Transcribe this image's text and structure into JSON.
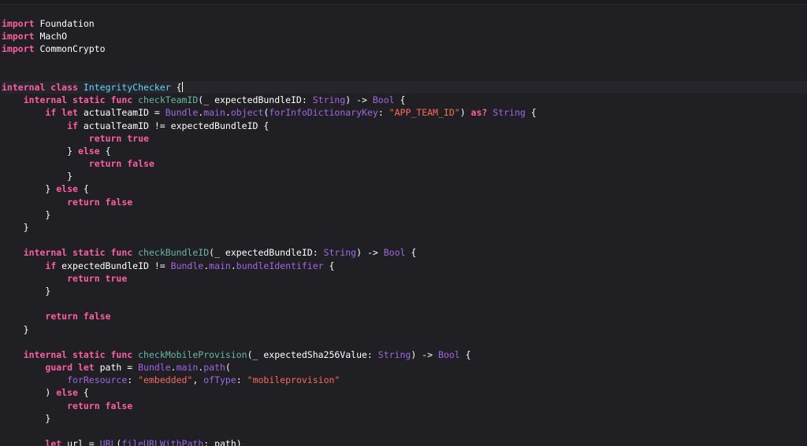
{
  "editor": {
    "colors": {
      "background": "#1f1f24",
      "keyword": "#fc5fa3",
      "type_declaration": "#5dd8ff",
      "function_declaration": "#67b7a4",
      "project_symbol": "#a167e6",
      "string": "#fc6a5d",
      "plain": "#ffffff"
    },
    "lines": [
      [
        {
          "c": "kw",
          "t": "import"
        },
        {
          "c": "pl",
          "t": " Foundation"
        }
      ],
      [
        {
          "c": "kw",
          "t": "import"
        },
        {
          "c": "pl",
          "t": " MachO"
        }
      ],
      [
        {
          "c": "kw",
          "t": "import"
        },
        {
          "c": "pl",
          "t": " CommonCrypto"
        }
      ],
      [],
      [],
      [
        {
          "c": "kw",
          "t": "internal class"
        },
        {
          "c": "pl",
          "t": " "
        },
        {
          "c": "ty",
          "t": "IntegrityChecker"
        },
        {
          "c": "pl",
          "t": " {"
        }
      ],
      [
        {
          "c": "pl",
          "t": "    "
        },
        {
          "c": "kw",
          "t": "internal static func"
        },
        {
          "c": "pl",
          "t": " "
        },
        {
          "c": "fn",
          "t": "checkTeamID"
        },
        {
          "c": "pl",
          "t": "(_ expectedBundleID: "
        },
        {
          "c": "pj",
          "t": "String"
        },
        {
          "c": "pl",
          "t": ") -> "
        },
        {
          "c": "pj",
          "t": "Bool"
        },
        {
          "c": "pl",
          "t": " {"
        }
      ],
      [
        {
          "c": "pl",
          "t": "        "
        },
        {
          "c": "kw",
          "t": "if let"
        },
        {
          "c": "pl",
          "t": " actualTeamID = "
        },
        {
          "c": "pj",
          "t": "Bundle"
        },
        {
          "c": "pl",
          "t": "."
        },
        {
          "c": "pj",
          "t": "main"
        },
        {
          "c": "pl",
          "t": "."
        },
        {
          "c": "pj",
          "t": "object"
        },
        {
          "c": "pl",
          "t": "("
        },
        {
          "c": "pj",
          "t": "forInfoDictionaryKey"
        },
        {
          "c": "pl",
          "t": ": "
        },
        {
          "c": "str",
          "t": "\"APP_TEAM_ID\""
        },
        {
          "c": "pl",
          "t": ") "
        },
        {
          "c": "kw",
          "t": "as?"
        },
        {
          "c": "pl",
          "t": " "
        },
        {
          "c": "pj",
          "t": "String"
        },
        {
          "c": "pl",
          "t": " {"
        }
      ],
      [
        {
          "c": "pl",
          "t": "            "
        },
        {
          "c": "kw",
          "t": "if"
        },
        {
          "c": "pl",
          "t": " actualTeamID != expectedBundleID {"
        }
      ],
      [
        {
          "c": "pl",
          "t": "                "
        },
        {
          "c": "kw",
          "t": "return true"
        }
      ],
      [
        {
          "c": "pl",
          "t": "            } "
        },
        {
          "c": "kw",
          "t": "else"
        },
        {
          "c": "pl",
          "t": " {"
        }
      ],
      [
        {
          "c": "pl",
          "t": "                "
        },
        {
          "c": "kw",
          "t": "return false"
        }
      ],
      [
        {
          "c": "pl",
          "t": "            }"
        }
      ],
      [
        {
          "c": "pl",
          "t": "        } "
        },
        {
          "c": "kw",
          "t": "else"
        },
        {
          "c": "pl",
          "t": " {"
        }
      ],
      [
        {
          "c": "pl",
          "t": "            "
        },
        {
          "c": "kw",
          "t": "return false"
        }
      ],
      [
        {
          "c": "pl",
          "t": "        }"
        }
      ],
      [
        {
          "c": "pl",
          "t": "    }"
        }
      ],
      [],
      [
        {
          "c": "pl",
          "t": "    "
        },
        {
          "c": "kw",
          "t": "internal static func"
        },
        {
          "c": "pl",
          "t": " "
        },
        {
          "c": "fn",
          "t": "checkBundleID"
        },
        {
          "c": "pl",
          "t": "(_ expectedBundleID: "
        },
        {
          "c": "pj",
          "t": "String"
        },
        {
          "c": "pl",
          "t": ") -> "
        },
        {
          "c": "pj",
          "t": "Bool"
        },
        {
          "c": "pl",
          "t": " {"
        }
      ],
      [
        {
          "c": "pl",
          "t": "        "
        },
        {
          "c": "kw",
          "t": "if"
        },
        {
          "c": "pl",
          "t": " expectedBundleID != "
        },
        {
          "c": "pj",
          "t": "Bundle"
        },
        {
          "c": "pl",
          "t": "."
        },
        {
          "c": "pj",
          "t": "main"
        },
        {
          "c": "pl",
          "t": "."
        },
        {
          "c": "pj",
          "t": "bundleIdentifier"
        },
        {
          "c": "pl",
          "t": " {"
        }
      ],
      [
        {
          "c": "pl",
          "t": "            "
        },
        {
          "c": "kw",
          "t": "return true"
        }
      ],
      [
        {
          "c": "pl",
          "t": "        }"
        }
      ],
      [],
      [
        {
          "c": "pl",
          "t": "        "
        },
        {
          "c": "kw",
          "t": "return false"
        }
      ],
      [
        {
          "c": "pl",
          "t": "    }"
        }
      ],
      [],
      [
        {
          "c": "pl",
          "t": "    "
        },
        {
          "c": "kw",
          "t": "internal static func"
        },
        {
          "c": "pl",
          "t": " "
        },
        {
          "c": "fn",
          "t": "checkMobileProvision"
        },
        {
          "c": "pl",
          "t": "(_ expectedSha256Value: "
        },
        {
          "c": "pj",
          "t": "String"
        },
        {
          "c": "pl",
          "t": ") -> "
        },
        {
          "c": "pj",
          "t": "Bool"
        },
        {
          "c": "pl",
          "t": " {"
        }
      ],
      [
        {
          "c": "pl",
          "t": "        "
        },
        {
          "c": "kw",
          "t": "guard let"
        },
        {
          "c": "pl",
          "t": " path = "
        },
        {
          "c": "pj",
          "t": "Bundle"
        },
        {
          "c": "pl",
          "t": "."
        },
        {
          "c": "pj",
          "t": "main"
        },
        {
          "c": "pl",
          "t": "."
        },
        {
          "c": "pj",
          "t": "path"
        },
        {
          "c": "pl",
          "t": "("
        }
      ],
      [
        {
          "c": "pl",
          "t": "            "
        },
        {
          "c": "pj",
          "t": "forResource"
        },
        {
          "c": "pl",
          "t": ": "
        },
        {
          "c": "str",
          "t": "\"embedded\""
        },
        {
          "c": "pl",
          "t": ", "
        },
        {
          "c": "pj",
          "t": "ofType"
        },
        {
          "c": "pl",
          "t": ": "
        },
        {
          "c": "str",
          "t": "\"mobileprovision\""
        }
      ],
      [
        {
          "c": "pl",
          "t": "        ) "
        },
        {
          "c": "kw",
          "t": "else"
        },
        {
          "c": "pl",
          "t": " {"
        }
      ],
      [
        {
          "c": "pl",
          "t": "            "
        },
        {
          "c": "kw",
          "t": "return false"
        }
      ],
      [
        {
          "c": "pl",
          "t": "        }"
        }
      ],
      [],
      [
        {
          "c": "pl",
          "t": "        "
        },
        {
          "c": "kw",
          "t": "let"
        },
        {
          "c": "pl",
          "t": " url = "
        },
        {
          "c": "pj",
          "t": "URL"
        },
        {
          "c": "pl",
          "t": "("
        },
        {
          "c": "pj",
          "t": "fileURLWithPath"
        },
        {
          "c": "pl",
          "t": ": path)"
        }
      ]
    ]
  }
}
